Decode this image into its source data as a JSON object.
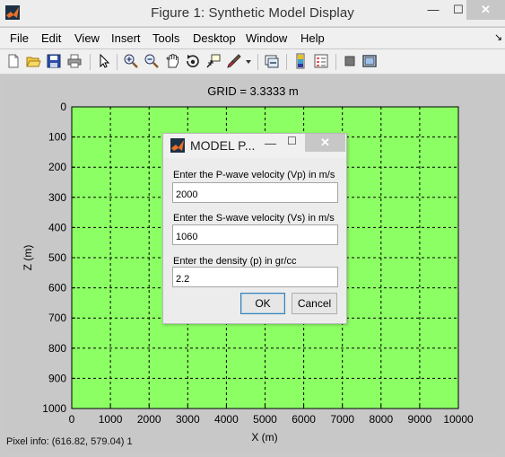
{
  "window": {
    "title": "Figure 1: Synthetic Model Display",
    "min_glyph": "—",
    "max_glyph": "☐",
    "close_glyph": "✕"
  },
  "menu": [
    "File",
    "Edit",
    "View",
    "Insert",
    "Tools",
    "Desktop",
    "Window",
    "Help"
  ],
  "menu_arrow": "↘",
  "toolbar_icons": [
    "new-figure-icon",
    "open-file-icon",
    "save-icon",
    "print-icon",
    "pointer-icon",
    "zoom-in-icon",
    "zoom-out-icon",
    "pan-icon",
    "rotate-3d-icon",
    "data-cursor-icon",
    "brush-icon",
    "link-plot-icon",
    "colorbar-icon",
    "legend-icon",
    "hide-plot-tools-icon",
    "show-plot-tools-icon"
  ],
  "plot": {
    "title": "GRID = 3.3333 m",
    "xlabel": "X (m)",
    "ylabel": "Z (m)",
    "xticks": [
      "0",
      "1000",
      "2000",
      "3000",
      "4000",
      "5000",
      "6000",
      "7000",
      "8000",
      "9000",
      "10000"
    ],
    "yticks": [
      "0",
      "100",
      "200",
      "300",
      "400",
      "500",
      "600",
      "700",
      "800",
      "900",
      "1000"
    ],
    "fill_color": "#8cff64",
    "grid": "dashed"
  },
  "status": {
    "pixel_info": "Pixel info: (616.82, 579.04)  1"
  },
  "dialog": {
    "title": "MODEL P...",
    "min_glyph": "—",
    "max_glyph": "☐",
    "close_glyph": "✕",
    "fields": [
      {
        "label": "Enter the P-wave velocity (Vp) in m/s",
        "value": "2000"
      },
      {
        "label": "Enter the S-wave velocity (Vs) in m/s",
        "value": "1060"
      },
      {
        "label": "Enter the density (p) in gr/cc",
        "value": "2.2"
      }
    ],
    "ok_label": "OK",
    "cancel_label": "Cancel"
  }
}
